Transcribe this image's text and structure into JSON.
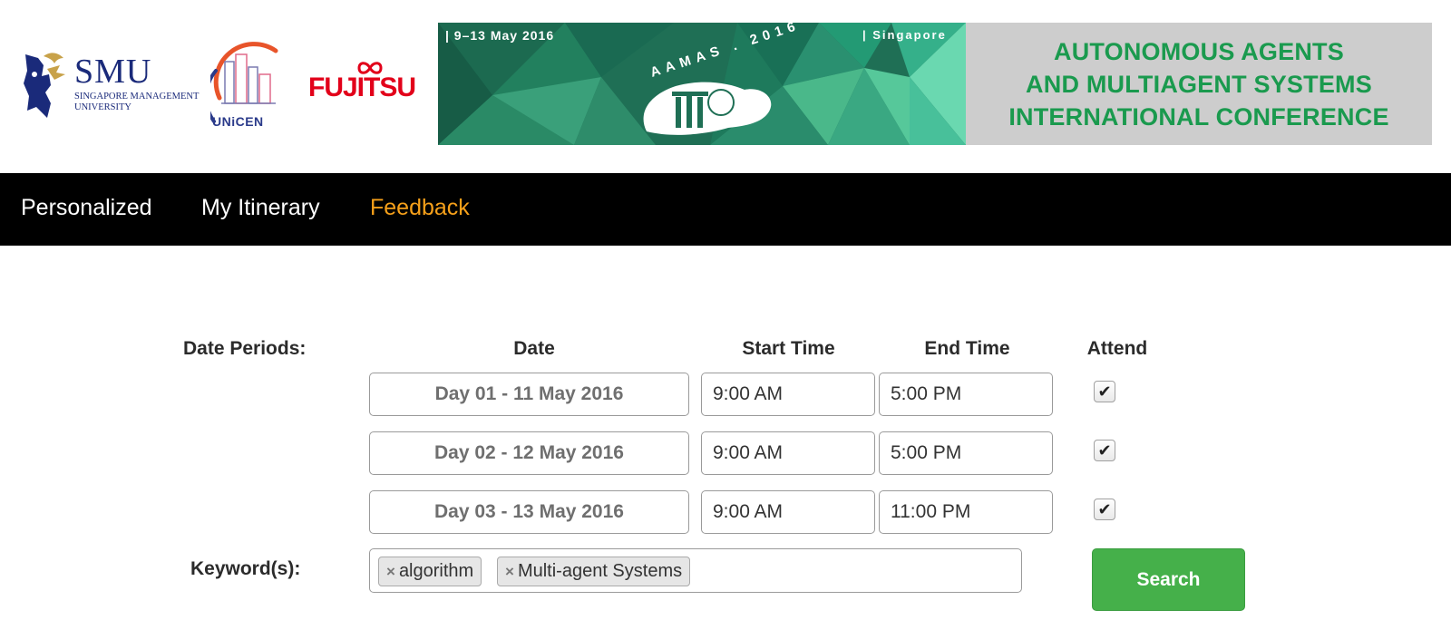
{
  "header": {
    "smu": {
      "name": "SMU",
      "subtitle_line1": "SINGAPORE MANAGEMENT",
      "subtitle_line2": "UNIVERSITY"
    },
    "unicen": {
      "name": "UNiCEN"
    },
    "fujitsu": {
      "name": "FUJITSU"
    },
    "banner": {
      "date": "| 9–13 May 2016",
      "city": "| Singapore",
      "event": "AAMAS . 2016",
      "title_lines": [
        "AUTONOMOUS AGENTS",
        "AND MULTIAGENT SYSTEMS",
        "INTERNATIONAL CONFERENCE"
      ]
    }
  },
  "nav": {
    "items": [
      {
        "label": "Personalized",
        "active": false
      },
      {
        "label": "My Itinerary",
        "active": false
      },
      {
        "label": "Feedback",
        "active": true
      }
    ]
  },
  "form": {
    "date_periods_label": "Date Periods:",
    "columns": {
      "date": "Date",
      "start": "Start Time",
      "end": "End Time",
      "attend": "Attend"
    },
    "rows": [
      {
        "date": "Day 01 - 11 May 2016",
        "start": "9:00 AM",
        "end": "5:00 PM",
        "attend": true
      },
      {
        "date": "Day 02 - 12 May 2016",
        "start": "9:00 AM",
        "end": "5:00 PM",
        "attend": true
      },
      {
        "date": "Day 03 - 13 May 2016",
        "start": "9:00 AM",
        "end": "11:00 PM",
        "attend": true
      }
    ],
    "keywords_label": "Keyword(s):",
    "keywords": [
      "algorithm",
      "Multi-agent Systems"
    ],
    "search_label": "Search"
  },
  "icons": {
    "check": "✔",
    "tag_remove": "×"
  },
  "colors": {
    "nav_bg": "#000000",
    "nav_active": "#f6a01a",
    "search_bg": "#45b04a",
    "banner_title": "#1a9a4e",
    "fujitsu": "#e2001a",
    "smu": "#1a2a7a"
  }
}
